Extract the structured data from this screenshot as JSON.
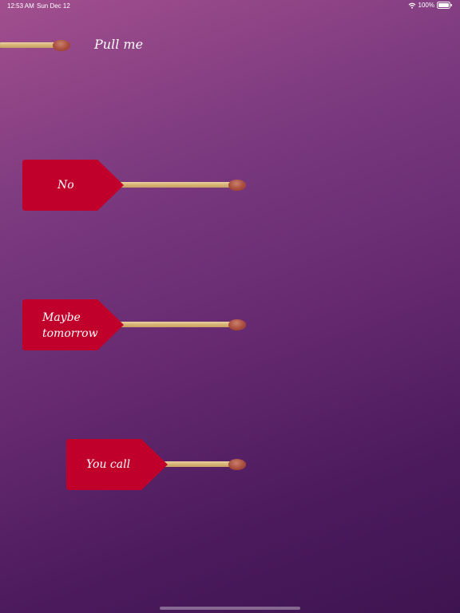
{
  "status_bar": {
    "time": "12:53 AM",
    "date": "Sun Dec 12",
    "battery": "100%"
  },
  "pull_label": "Pull me",
  "matches": [
    {
      "label_lines": [
        "No"
      ]
    },
    {
      "label_lines": [
        "Maybe",
        "tomorrow"
      ]
    },
    {
      "label_lines": [
        "You call"
      ]
    }
  ],
  "colors": {
    "tag": "#c0002a",
    "match_head": "#a94d3d",
    "stick": "#d9b67a"
  }
}
